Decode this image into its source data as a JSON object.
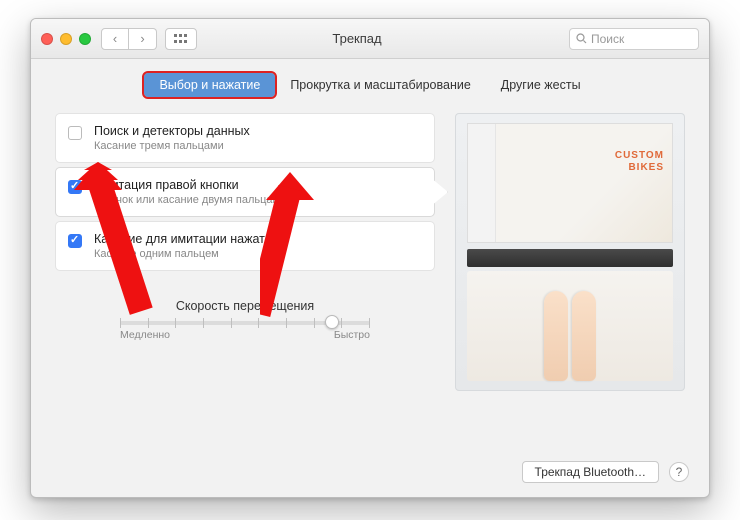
{
  "window": {
    "title": "Трекпад"
  },
  "search": {
    "placeholder": "Поиск"
  },
  "tabs": [
    {
      "label": "Выбор и нажатие",
      "selected": true
    },
    {
      "label": "Прокрутка и масштабирование",
      "selected": false
    },
    {
      "label": "Другие жесты",
      "selected": false
    }
  ],
  "options": [
    {
      "title": "Поиск и детекторы данных",
      "subtitle": "Касание тремя пальцами",
      "checked": false
    },
    {
      "title": "Имитация правой кнопки",
      "subtitle": "Щелчок или касание двумя пальцами",
      "checked": true,
      "dropdown": true,
      "highlight": true
    },
    {
      "title": "Касание для имитации нажатия",
      "subtitle": "Касание одним пальцем",
      "checked": true
    }
  ],
  "slider": {
    "title": "Скорость перемещения",
    "min_label": "Медленно",
    "max_label": "Быстро"
  },
  "preview": {
    "headline1": "CUSTOM",
    "headline2": "BIKES"
  },
  "bottom": {
    "bluetooth": "Трекпад Bluetooth…"
  }
}
